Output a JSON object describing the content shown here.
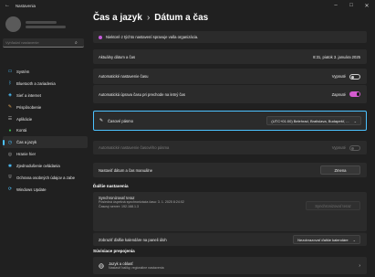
{
  "window": {
    "title": "Nastavenia"
  },
  "sidebar": {
    "search_placeholder": "Vyhľadať nastavenie",
    "items": [
      {
        "label": "Systém",
        "icon": "monitor-icon",
        "color": "#4cc2ff"
      },
      {
        "label": "Bluetooth a zariadenia",
        "icon": "bluetooth-icon",
        "color": "#4cc2ff"
      },
      {
        "label": "Sieť a internet",
        "icon": "wifi-icon",
        "color": "#4cc2ff"
      },
      {
        "label": "Prispôsobenie",
        "icon": "brush-icon",
        "color": "#e0a050"
      },
      {
        "label": "Aplikácie",
        "icon": "apps-icon",
        "color": "#b0b0b0"
      },
      {
        "label": "Kontá",
        "icon": "person-icon",
        "color": "#3fb950"
      },
      {
        "label": "Čas a jazyk",
        "icon": "clock-globe-icon",
        "color": "#4cc2ff",
        "active": true
      },
      {
        "label": "Hranie hier",
        "icon": "gamepad-icon",
        "color": "#b0b0b0"
      },
      {
        "label": "Zjednodušenie ovládania",
        "icon": "accessibility-icon",
        "color": "#4cc2ff"
      },
      {
        "label": "Ochrana osobných údajov a zabe",
        "icon": "shield-icon",
        "color": "#9a9a9a"
      },
      {
        "label": "Windows Update",
        "icon": "update-icon",
        "color": "#4cc2ff"
      }
    ]
  },
  "header": {
    "parent": "Čas a jazyk",
    "separator": "›",
    "title": "Dátum a čas"
  },
  "info_bar": {
    "text": "Niektoré z týchto nastavení spravuje vaša organizácia."
  },
  "rows": {
    "current_date": {
      "label": "Aktuálny dátum a čas",
      "value": "8:31, piatok 3. januára 2025"
    },
    "auto_time": {
      "label": "Automatické nastavenie času",
      "state": "Vypnuté"
    },
    "dst": {
      "label": "Automatická úprava času pri prechode na letný čas",
      "state": "Zapnuté"
    },
    "timezone": {
      "label": "Časové pásmo",
      "value": "(UTC+01:00) Belehrad, Bratislava, Budapešť, ..."
    },
    "auto_tz": {
      "label": "Automatické nastavenie časového pásma",
      "state": "Vypnuté"
    },
    "manual": {
      "label": "Nastaviť dátum a čas manuálne",
      "button": "Zmena"
    }
  },
  "additional": {
    "title": "Ďalšie nastavenia",
    "sync_title": "Synchronizovať teraz",
    "sync_last": "Posledná úspešná synchronizácia času: 3. 1. 2025 8:24:02",
    "sync_server": "Časový server: 192.168.1.3",
    "sync_button": "Synchronizovať teraz",
    "calendar_label": "Zobraziť ďalšie kalendáre na paneli úloh",
    "calendar_value": "Nezobrazovať ďalšie kalendáre"
  },
  "related": {
    "title": "Súvisiace prepojenia",
    "link_title": "Jazyk a oblasť",
    "link_subtitle": "Nastaviť balíky, regionálne nastavenia"
  },
  "colors": {
    "accent": "#4cc2ff",
    "toggle_on": "#d55bd0",
    "highlight_border": "#4cc2ff"
  }
}
